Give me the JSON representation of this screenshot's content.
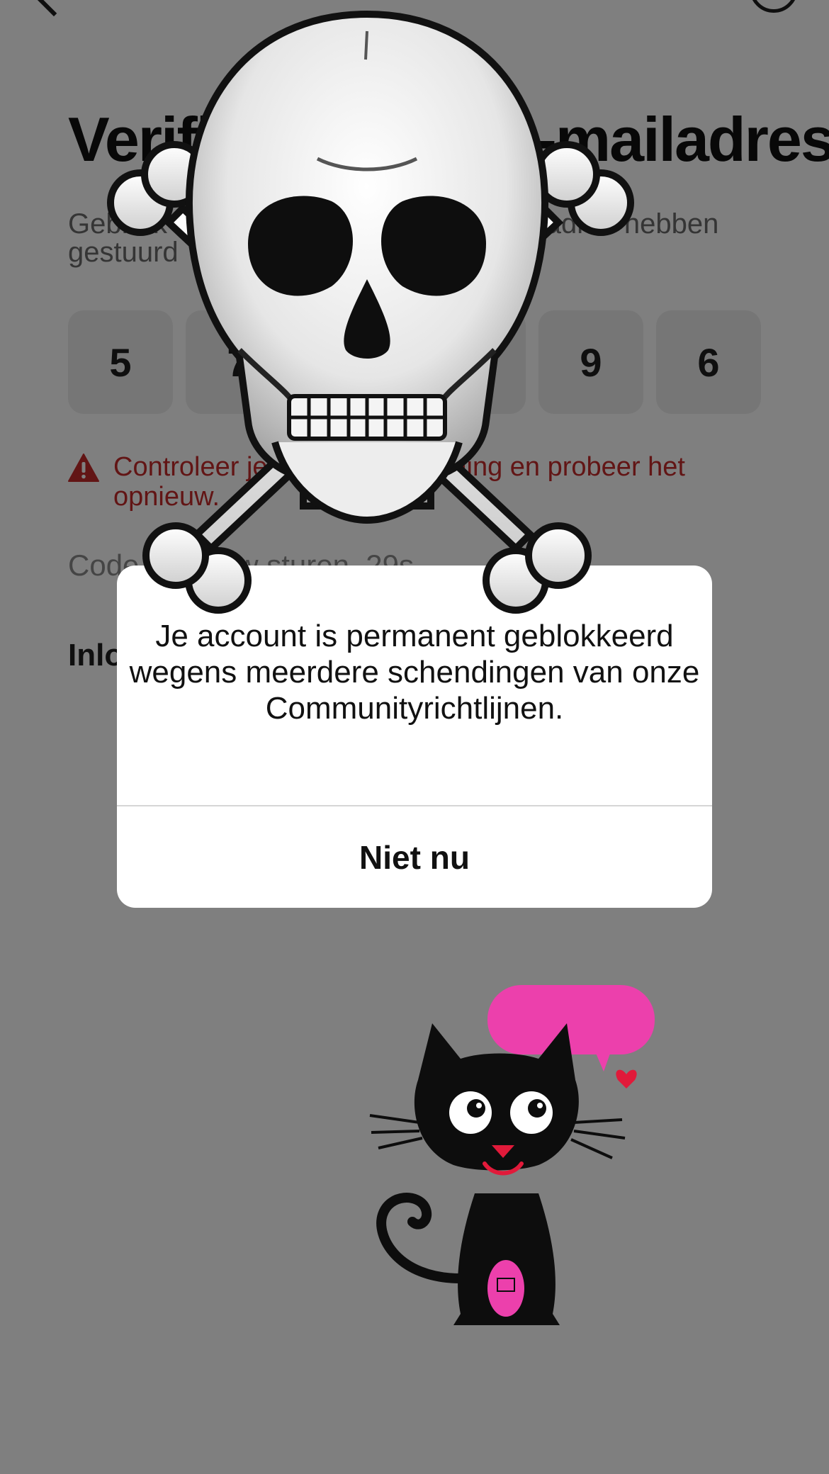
{
  "screen": {
    "title": "Verificatiecode e-mailadres",
    "subtitle": "Gebruik de code die we naar je e-mailadres hebben gestuurd",
    "code_digits": [
      "5",
      "7",
      "",
      "",
      "9",
      "6"
    ],
    "error_text": "Controleer je code en verbinding en probeer het opnieuw.",
    "resend_text": "Code opnieuw sturen, 29s",
    "login_link": "Inloggen"
  },
  "dialog": {
    "message": "Je account is permanent geblokkeerd wegens meerdere schendingen van onze Communityrichtlijnen.",
    "button_label": "Niet nu"
  },
  "colors": {
    "overlay": "#7d7d7d",
    "error": "#c42b2b",
    "sticker_pink": "#ec40ac"
  },
  "stickers": [
    "skull-and-crossbones",
    "black-cat-with-speech-bubble"
  ]
}
